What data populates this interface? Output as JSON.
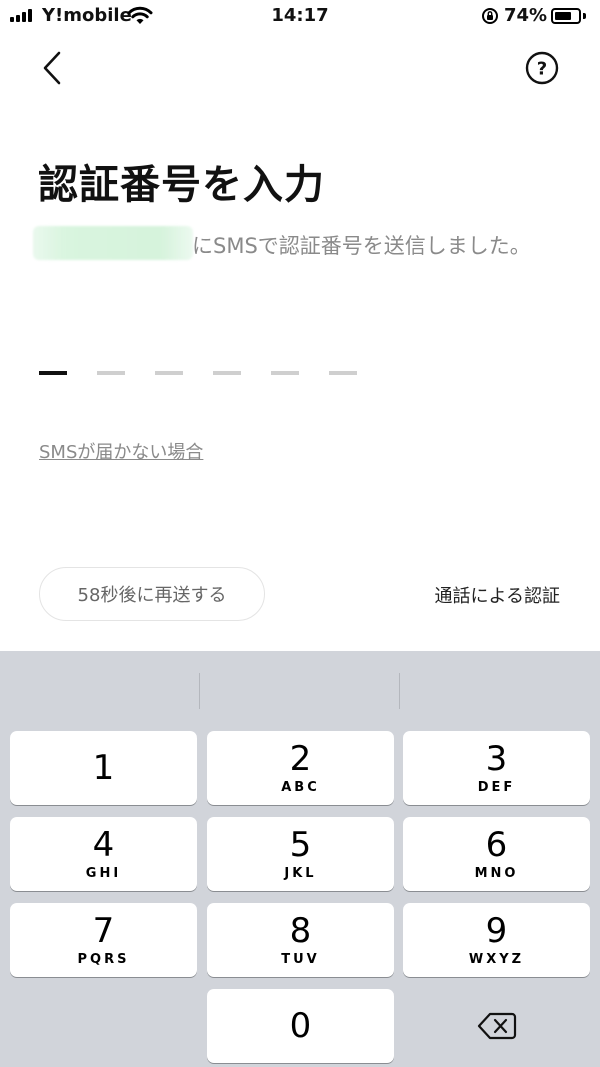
{
  "status_bar": {
    "carrier": "Y!mobile",
    "time": "14:17",
    "battery_percent": "74%",
    "battery_level": 0.74
  },
  "nav": {
    "back_icon": "chevron-left-icon",
    "help_icon": "question-circle-icon"
  },
  "content": {
    "title": "認証番号を入力",
    "sms_sent_message": "にSMSで認証番号を送信しました。",
    "code_length": 6,
    "sms_help_link": "SMSが届かない場合",
    "resend_button": "58秒後に再送する",
    "call_verify_link": "通話による認証"
  },
  "keyboard": {
    "keys": [
      {
        "num": "1",
        "letters": ""
      },
      {
        "num": "2",
        "letters": "ABC"
      },
      {
        "num": "3",
        "letters": "DEF"
      },
      {
        "num": "4",
        "letters": "GHI"
      },
      {
        "num": "5",
        "letters": "JKL"
      },
      {
        "num": "6",
        "letters": "MNO"
      },
      {
        "num": "7",
        "letters": "PQRS"
      },
      {
        "num": "8",
        "letters": "TUV"
      },
      {
        "num": "9",
        "letters": "WXYZ"
      },
      {
        "num": "0",
        "letters": ""
      }
    ],
    "delete_icon": "backspace-icon"
  },
  "colors": {
    "active_slot": "#111111",
    "inactive_slot": "#cfcfcf",
    "keyboard_bg": "#d1d4da",
    "muted_text": "#8a8a8a"
  }
}
